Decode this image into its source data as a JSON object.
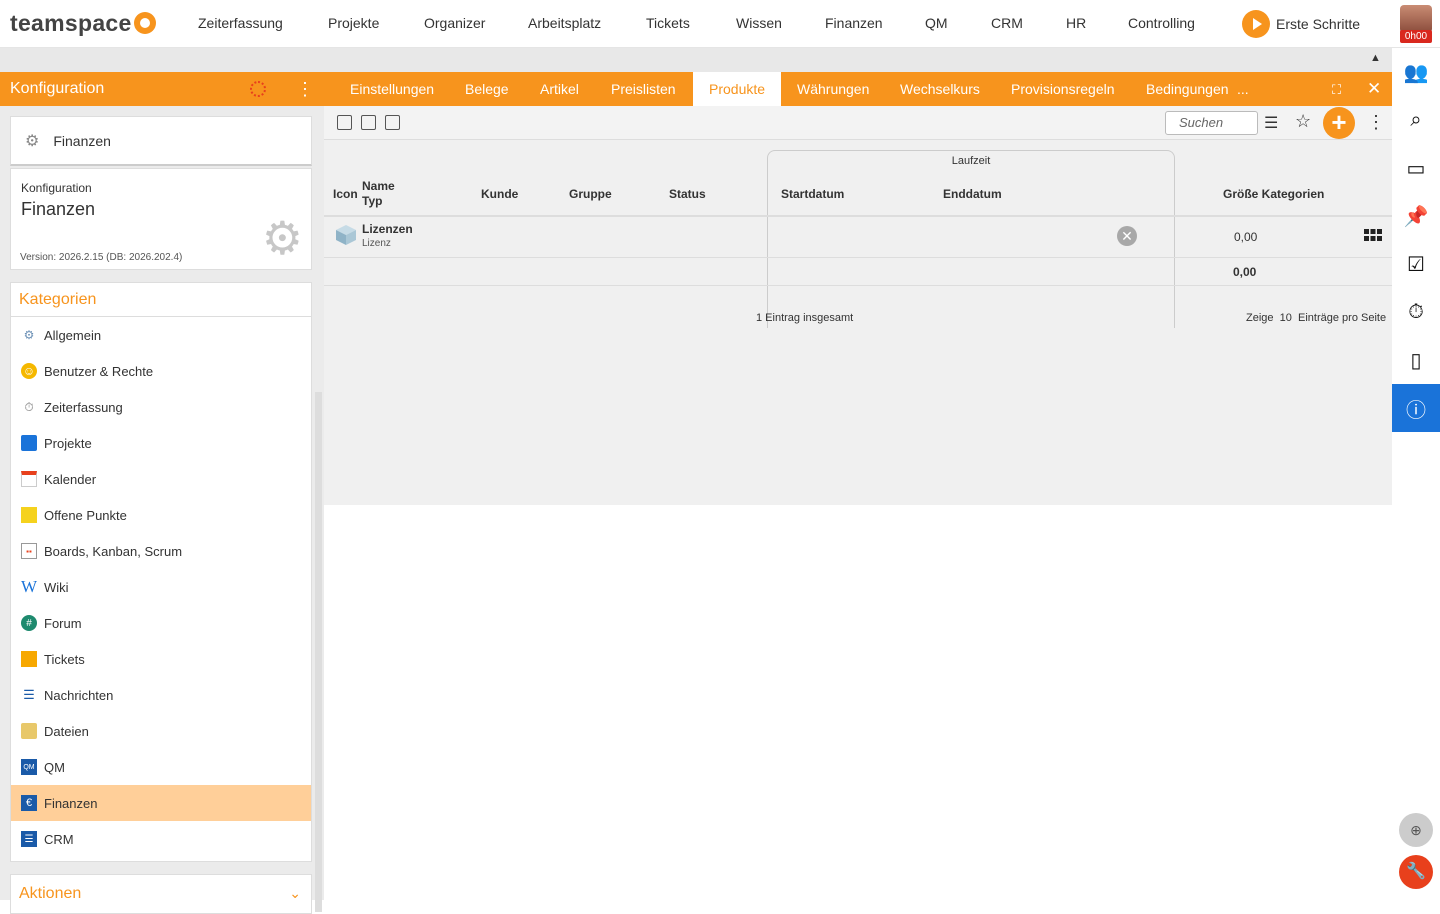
{
  "app": {
    "logo": "teamspace",
    "user_badge": "0h00"
  },
  "topnav": [
    "Zeiterfassung",
    "Projekte",
    "Organizer",
    "Arbeitsplatz",
    "Tickets",
    "Wissen",
    "Finanzen",
    "QM",
    "CRM",
    "HR",
    "Controlling"
  ],
  "erste_schritte": "Erste Schritte",
  "left": {
    "header": "Konfiguration",
    "module": "Finanzen",
    "info": {
      "label": "Konfiguration",
      "value": "Finanzen",
      "version": "Version: 2026.2.15 (DB: 2026.202.4)"
    },
    "categories_title": "Kategorien",
    "categories": [
      "Allgemein",
      "Benutzer & Rechte",
      "Zeiterfassung",
      "Projekte",
      "Kalender",
      "Offene Punkte",
      "Boards, Kanban, Scrum",
      "Wiki",
      "Forum",
      "Tickets",
      "Nachrichten",
      "Dateien",
      "QM",
      "Finanzen",
      "CRM"
    ],
    "selected_category": "Finanzen",
    "actions_title": "Aktionen"
  },
  "tabs": [
    "Einstellungen",
    "Belege",
    "Artikel",
    "Preislisten",
    "Produkte",
    "Währungen",
    "Wechselkurs",
    "Provisionsregeln",
    "Bedingungen",
    "..."
  ],
  "active_tab": "Produkte",
  "search_placeholder": "Suchen",
  "table": {
    "group_header": "Laufzeit",
    "headers": {
      "icon": "Icon",
      "name": "Name",
      "typ": "Typ",
      "kunde": "Kunde",
      "gruppe": "Gruppe",
      "status": "Status",
      "start": "Startdatum",
      "end": "Enddatum",
      "size": "Größe Kategorien"
    },
    "rows": [
      {
        "name": "Lizenzen",
        "typ": "Lizenz",
        "kunde": "",
        "gruppe": "",
        "status": "",
        "start": "",
        "end": "",
        "size": "0,00"
      }
    ],
    "total": "0,00",
    "count_text": "1 Eintrag insgesamt",
    "per_page_prefix": "Zeige",
    "per_page": "10",
    "per_page_suffix": "Einträge pro Seite"
  },
  "colors": {
    "accent": "#f7941d",
    "selected": "#ffcf99",
    "info_active": "#1a73d9"
  }
}
